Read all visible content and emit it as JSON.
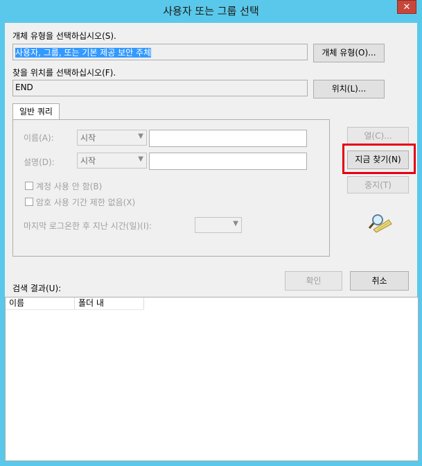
{
  "window": {
    "title": "사용자 또는 그룹 선택",
    "close_glyph": "✕"
  },
  "object_type": {
    "label": "개체 유형을 선택하십시오(S).",
    "value": "사용자, 그룹, 또는 기본 제공 보안 주체",
    "button": "개체 유형(O)..."
  },
  "location": {
    "label": "찾을 위치를 선택하십시오(F).",
    "value": "END",
    "button": "위치(L)..."
  },
  "tabs": [
    {
      "label": "일반 쿼리"
    }
  ],
  "query": {
    "name_label": "이름(A):",
    "name_mode": "시작",
    "desc_label": "설명(D):",
    "desc_mode": "시작",
    "disabled_accounts": "계정 사용 안 함(B)",
    "non_expiring": "암호 사용 기간 제한 없음(X)",
    "last_logon_label": "마지막 로그온한 후 지난 시간(일)(I):"
  },
  "side_buttons": {
    "columns": "열(C)...",
    "find_now": "지금 찾기(N)",
    "stop": "중지(T)"
  },
  "dialog_buttons": {
    "ok": "확인",
    "cancel": "취소"
  },
  "results": {
    "label": "검색 결과(U):",
    "columns": [
      "이름",
      "폴더 내"
    ]
  },
  "colors": {
    "title_bar": "#5ac8ea",
    "highlight": "#e60012",
    "selection": "#3399ff"
  }
}
